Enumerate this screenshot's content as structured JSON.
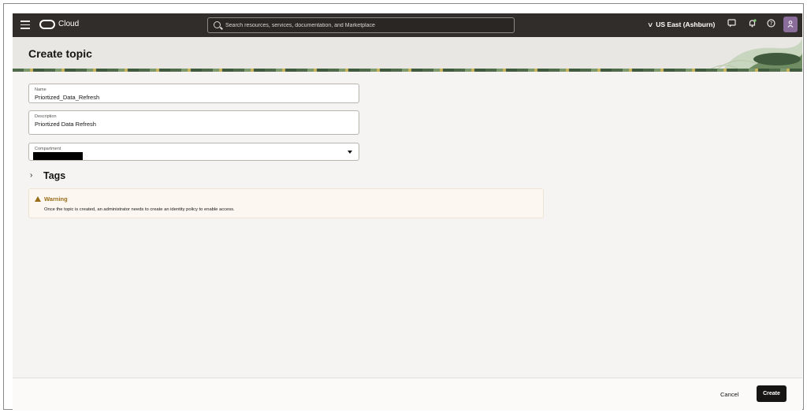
{
  "topbar": {
    "brand": "Cloud",
    "search_placeholder": "Search resources, services, documentation, and Marketplace",
    "region": "US East (Ashburn)",
    "icons": [
      "menu-icon",
      "oracle-logo-icon",
      "search-icon",
      "chevron-down-icon",
      "chat-icon",
      "bell-icon",
      "help-icon",
      "user-icon"
    ]
  },
  "header": {
    "title": "Create topic"
  },
  "form": {
    "name": {
      "label": "Name",
      "value": "Priortized_Data_Refresh"
    },
    "description": {
      "label": "Description",
      "value": "Priortized Data Refresh"
    },
    "compartment": {
      "label": "Compartment"
    }
  },
  "tags": {
    "label": "Tags"
  },
  "warning": {
    "title": "Warning",
    "text": "Once the topic is created, an administrator needs to create an identity policy to enable access."
  },
  "footer": {
    "cancel_label": "Cancel",
    "create_label": "Create"
  },
  "colors": {
    "topbar": "#312d2a",
    "primary_button": "#161513",
    "warning_text": "#9a6f1a",
    "avatar": "#8a6c9a"
  }
}
